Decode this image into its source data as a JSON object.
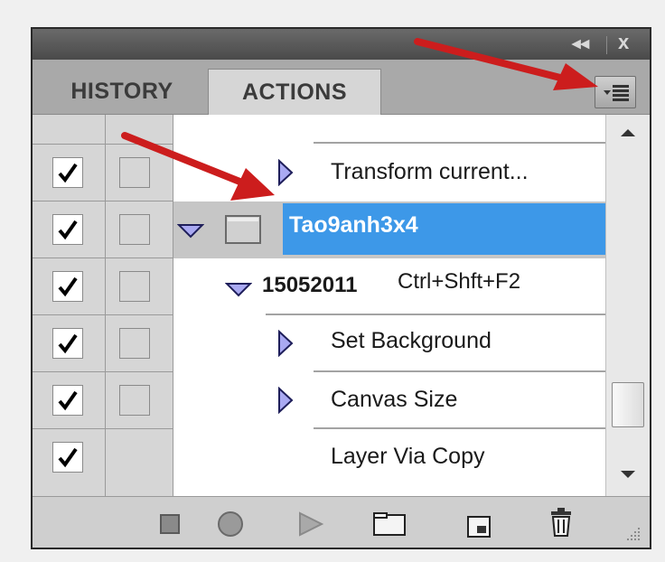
{
  "titlebar": {
    "collapse_glyph": "◂◂",
    "close_glyph": "x"
  },
  "tabs": [
    {
      "label": "HISTORY",
      "active": false
    },
    {
      "label": "ACTIONS",
      "active": true
    }
  ],
  "panel_menu_icon": "panel-menu-icon",
  "actions": {
    "partial_top_text": "...",
    "items": [
      {
        "label": "Transform current...",
        "checked": true,
        "dialog": false,
        "level": "step",
        "selected": false
      },
      {
        "label": "Tao9anh3x4",
        "checked": true,
        "dialog": false,
        "level": "set",
        "expanded": true,
        "selected": true
      },
      {
        "label": "15052011",
        "shortcut": "Ctrl+Shft+F2",
        "checked": true,
        "dialog": false,
        "level": "action",
        "expanded": true
      },
      {
        "label": "Set Background",
        "checked": true,
        "dialog": false,
        "level": "step"
      },
      {
        "label": "Canvas Size",
        "checked": true,
        "dialog": false,
        "level": "step"
      },
      {
        "label": "Layer Via Copy",
        "checked": true,
        "dialog": false,
        "level": "step"
      }
    ]
  },
  "bottom_toolbar": [
    "stop-icon",
    "record-icon",
    "play-icon",
    "new-set-folder-icon",
    "new-action-icon",
    "trash-icon",
    "resize-grip-icon"
  ],
  "colors": {
    "selection": "#3d98e8",
    "arrow": "#cc1d1d",
    "panel": "#d6d6d6"
  }
}
